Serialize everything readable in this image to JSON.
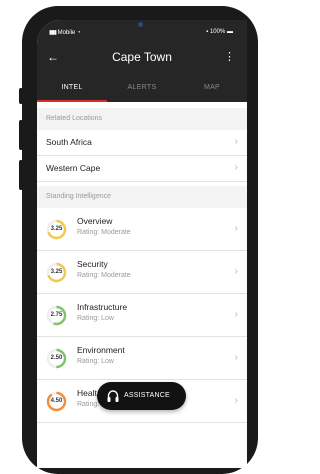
{
  "status_bar": {
    "carrier": "Mobile",
    "battery": "100%"
  },
  "header": {
    "title": "Cape Town",
    "back_icon": "arrow-left-icon",
    "menu_icon": "kebab-icon"
  },
  "tabs": [
    {
      "label": "INTEL",
      "active": true
    },
    {
      "label": "ALERTS",
      "active": false
    },
    {
      "label": "MAP",
      "active": false
    }
  ],
  "related": {
    "heading": "Related Locations",
    "items": [
      {
        "label": "South Africa"
      },
      {
        "label": "Western Cape"
      }
    ]
  },
  "standing": {
    "heading": "Standing Intelligence",
    "items": [
      {
        "name": "Overview",
        "score": "3.25",
        "rating": "Rating: Moderate",
        "color": "#f2c94c"
      },
      {
        "name": "Security",
        "score": "3.25",
        "rating": "Rating: Moderate",
        "color": "#f2c94c"
      },
      {
        "name": "Infrastructure",
        "score": "2.75",
        "rating": "Rating: Low",
        "color": "#7cc36a"
      },
      {
        "name": "Environment",
        "score": "2.50",
        "rating": "Rating: Low",
        "color": "#7cc36a"
      },
      {
        "name": "Healt",
        "score": "4.50",
        "rating": "Rating: High",
        "color": "#f08c3c"
      }
    ]
  },
  "assistance": {
    "label": "ASSISTANCE",
    "icon": "headphones-icon"
  },
  "colors": {
    "header_bg": "#262626",
    "accent": "#d8312c"
  }
}
